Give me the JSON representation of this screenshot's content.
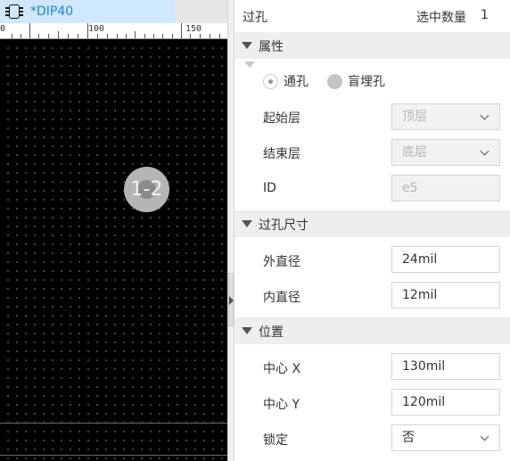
{
  "tab": {
    "label": "*DIP40",
    "icon": "chip-icon"
  },
  "ruler": {
    "labels": [
      "0",
      "100",
      "150"
    ]
  },
  "canvas": {
    "via_net_label": "1-2"
  },
  "panel": {
    "title": "过孔",
    "selected_count_label": "选中数量",
    "selected_count": "1",
    "sections": {
      "attributes": "属性",
      "via_size": "过孔尺寸",
      "position": "位置"
    },
    "via_type": {
      "through": "通孔",
      "blind": "盲埋孔",
      "selected": "通孔"
    },
    "start_layer": {
      "label": "起始层",
      "value": "顶层"
    },
    "end_layer": {
      "label": "结束层",
      "value": "底层"
    },
    "id": {
      "label": "ID",
      "value": "e5"
    },
    "outer_diameter": {
      "label": "外直径",
      "value": "24mil"
    },
    "inner_diameter": {
      "label": "内直径",
      "value": "12mil"
    },
    "center_x": {
      "label": "中心 X",
      "value": "130mil"
    },
    "center_y": {
      "label": "中心 Y",
      "value": "120mil"
    },
    "lock": {
      "label": "锁定",
      "value": "否"
    }
  },
  "colors": {
    "canvas_bg": "#000000",
    "tab_bg": "#cfe8fb",
    "tab_text": "#1f86d8",
    "via": "#b5b5b5",
    "section_bg": "#eeeeee"
  }
}
